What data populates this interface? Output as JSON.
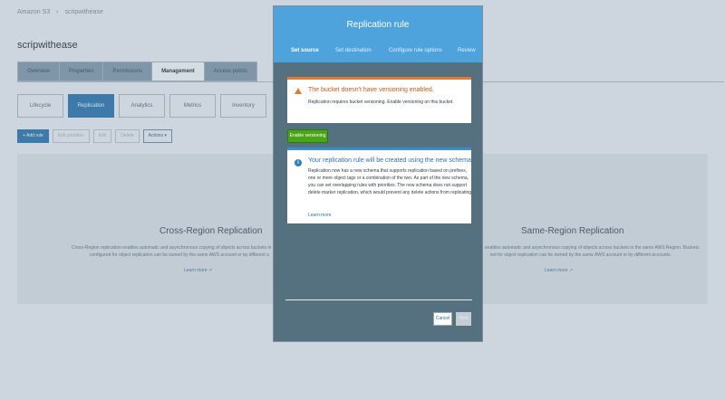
{
  "breadcrumb": {
    "root": "Amazon S3",
    "separator": "›",
    "bucket": "scripwithease"
  },
  "bucket_title": "scripwithease",
  "tabs": [
    "Overview",
    "Properties",
    "Permissions",
    "Management",
    "Access points"
  ],
  "active_tab": "Management",
  "subtabs": [
    "Lifecycle",
    "Replication",
    "Analytics",
    "Metrics",
    "Inventory"
  ],
  "active_subtab": "Replication",
  "actions": {
    "add_rule": "+ Add rule",
    "edit_priorities": "Edit priorities",
    "edit": "Edit",
    "delete": "Delete",
    "actions": "Actions ▾"
  },
  "cards": {
    "cross": {
      "title": "Cross-Region Replication",
      "desc_1": "Cross-Region replication enables automatic and asynchronous copying of objects across buckets in different",
      "desc_2": "configured for object replication can be owned by the same AWS account or by different a",
      "link": "Learn more ↗"
    },
    "same": {
      "title": "Same-Region Replication",
      "desc_1": "enables automatic and asynchronous copying of objects across buckets in the same AWS Region. Buckets",
      "desc_2": "ied for object replication can be owned by the same AWS account or by different accounts.",
      "link": "Learn more ↗"
    }
  },
  "modal": {
    "title": "Replication rule",
    "steps": [
      "Set source",
      "Set destination",
      "Configure rule options",
      "Review"
    ],
    "active_step": "Set source",
    "warning": {
      "title": "The bucket doesn't have versioning enabled.",
      "text": "Replication requires bucket versioning. Enable versioning on this bucket."
    },
    "enable_versioning": "Enable versioning",
    "info": {
      "title": "Your replication rule will be created using the new schema",
      "lines": [
        "Replication now has a new schema that supports replication based on prefixes,",
        "one or more object tags or a combination of the two. As part of the new schema,",
        "you can set overlapping rules with priorities. The new schema does not support",
        "delete marker replication, which would prevent any delete actions from replicating."
      ],
      "link": "Learn more"
    },
    "cancel": "Cancel",
    "next": "Next"
  },
  "colors": {
    "header_blue": "#4ea3dc",
    "warning_orange": "#e07c32",
    "info_blue": "#3a8ccd",
    "enable_green": "#4ba416"
  }
}
